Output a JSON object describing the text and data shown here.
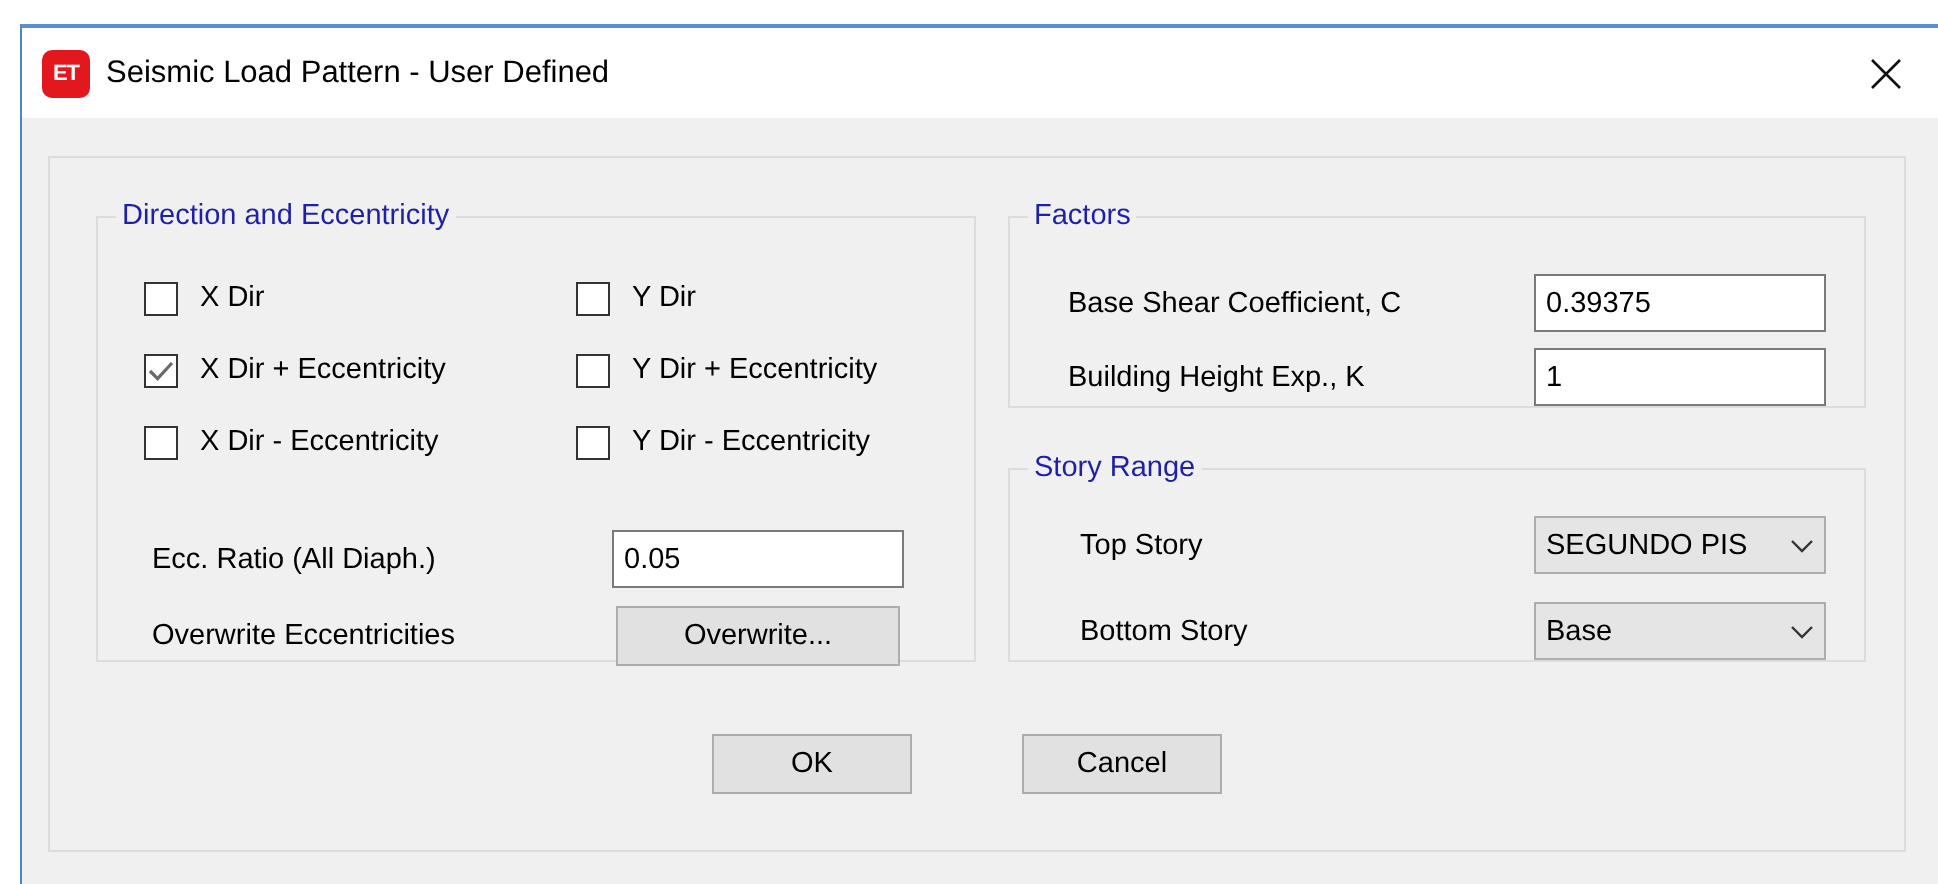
{
  "window": {
    "icon_text": "ET",
    "title": "Seismic Load Pattern - User Defined"
  },
  "direction": {
    "title": "Direction and Eccentricity",
    "options": [
      {
        "label": "X Dir",
        "checked": false
      },
      {
        "label": "Y Dir",
        "checked": false
      },
      {
        "label": "X Dir + Eccentricity",
        "checked": true
      },
      {
        "label": "Y Dir + Eccentricity",
        "checked": false
      },
      {
        "label": "X Dir - Eccentricity",
        "checked": false
      },
      {
        "label": "Y Dir - Eccentricity",
        "checked": false
      }
    ],
    "ecc_ratio": {
      "label": "Ecc. Ratio (All Diaph.)",
      "value": "0.05"
    },
    "overwrite": {
      "label": "Overwrite Eccentricities",
      "button": "Overwrite..."
    }
  },
  "factors": {
    "title": "Factors",
    "fields": [
      {
        "label": "Base Shear Coefficient, C",
        "value": "0.39375"
      },
      {
        "label": "Building Height Exp., K",
        "value": "1"
      }
    ]
  },
  "story_range": {
    "title": "Story Range",
    "fields": [
      {
        "label": "Top Story",
        "value": "SEGUNDO PIS"
      },
      {
        "label": "Bottom Story",
        "value": "Base"
      }
    ]
  },
  "buttons": [
    "OK",
    "Cancel"
  ]
}
